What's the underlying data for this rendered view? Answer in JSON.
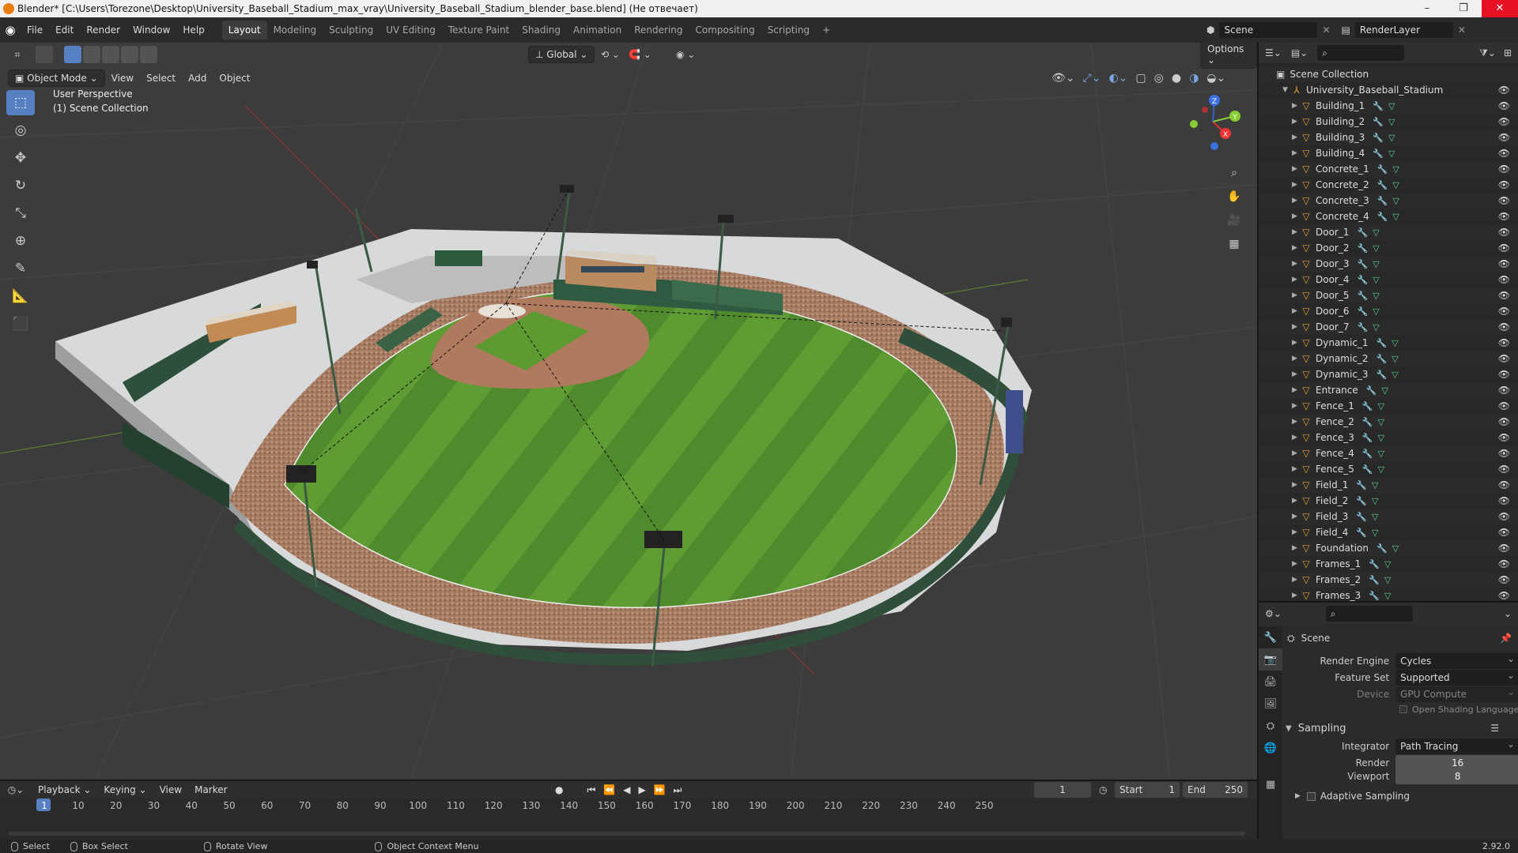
{
  "window": {
    "title": "Blender* [C:\\Users\\Torezone\\Desktop\\University_Baseball_Stadium_max_vray\\University_Baseball_Stadium_blender_base.blend] (Не отвечает)",
    "controls": [
      "–",
      "❐",
      "✕"
    ]
  },
  "menu": [
    "File",
    "Edit",
    "Render",
    "Window",
    "Help"
  ],
  "workspaces": [
    "Layout",
    "Modeling",
    "Sculpting",
    "UV Editing",
    "Texture Paint",
    "Shading",
    "Animation",
    "Rendering",
    "Compositing",
    "Scripting",
    "+"
  ],
  "active_workspace": "Layout",
  "scene": {
    "name": "Scene",
    "view_layer": "RenderLayer"
  },
  "viewport": {
    "mode": "Object Mode",
    "header_menus": [
      "View",
      "Select",
      "Add",
      "Object"
    ],
    "transform_orientation": "Global",
    "options_label": "Options",
    "overlay_lines": [
      "User Perspective",
      "(1) Scene Collection"
    ],
    "gizmo_axes": [
      "X",
      "Y",
      "Z"
    ]
  },
  "tools": [
    {
      "name": "select-box-tool",
      "glyph": "⬚"
    },
    {
      "name": "cursor-tool",
      "glyph": "◎"
    },
    {
      "name": "move-tool",
      "glyph": "✥"
    },
    {
      "name": "rotate-tool",
      "glyph": "↻"
    },
    {
      "name": "scale-tool",
      "glyph": "⤡"
    },
    {
      "name": "transform-tool",
      "glyph": "⊕"
    },
    {
      "name": "annotate-tool",
      "glyph": "✎"
    },
    {
      "name": "measure-tool",
      "glyph": "📐"
    },
    {
      "name": "add-cube-tool",
      "glyph": "⬛"
    }
  ],
  "outliner": {
    "root": "Scene Collection",
    "collection": "University_Baseball_Stadium",
    "objects": [
      "Building_1",
      "Building_2",
      "Building_3",
      "Building_4",
      "Concrete_1",
      "Concrete_2",
      "Concrete_3",
      "Concrete_4",
      "Door_1",
      "Door_2",
      "Door_3",
      "Door_4",
      "Door_5",
      "Door_6",
      "Door_7",
      "Dynamic_1",
      "Dynamic_2",
      "Dynamic_3",
      "Entrance",
      "Fence_1",
      "Fence_2",
      "Fence_3",
      "Fence_4",
      "Fence_5",
      "Field_1",
      "Field_2",
      "Field_3",
      "Field_4",
      "Foundation",
      "Frames_1",
      "Frames_2",
      "Frames_3"
    ]
  },
  "properties": {
    "context": "Scene",
    "render_engine_label": "Render Engine",
    "render_engine": "Cycles",
    "feature_set_label": "Feature Set",
    "feature_set": "Supported",
    "device_label": "Device",
    "device": "GPU Compute",
    "osl_label": "Open Shading Language",
    "sampling_label": "Sampling",
    "integrator_label": "Integrator",
    "integrator": "Path Tracing",
    "render_label": "Render",
    "render_samples": "16",
    "viewport_label": "Viewport",
    "viewport_samples": "8",
    "adaptive_label": "Adaptive Sampling"
  },
  "timeline": {
    "menus": [
      "Playback",
      "Keying",
      "View",
      "Marker"
    ],
    "current_frame": "1",
    "start_label": "Start",
    "start": "1",
    "end_label": "End",
    "end": "250",
    "ticks": [
      "1",
      "10",
      "20",
      "30",
      "40",
      "50",
      "60",
      "70",
      "80",
      "90",
      "100",
      "110",
      "120",
      "130",
      "140",
      "150",
      "160",
      "170",
      "180",
      "190",
      "200",
      "210",
      "220",
      "230",
      "240",
      "250"
    ]
  },
  "status": {
    "items": [
      "Select",
      "Box Select",
      "Rotate View",
      "Object Context Menu"
    ],
    "version": "2.92.0"
  }
}
